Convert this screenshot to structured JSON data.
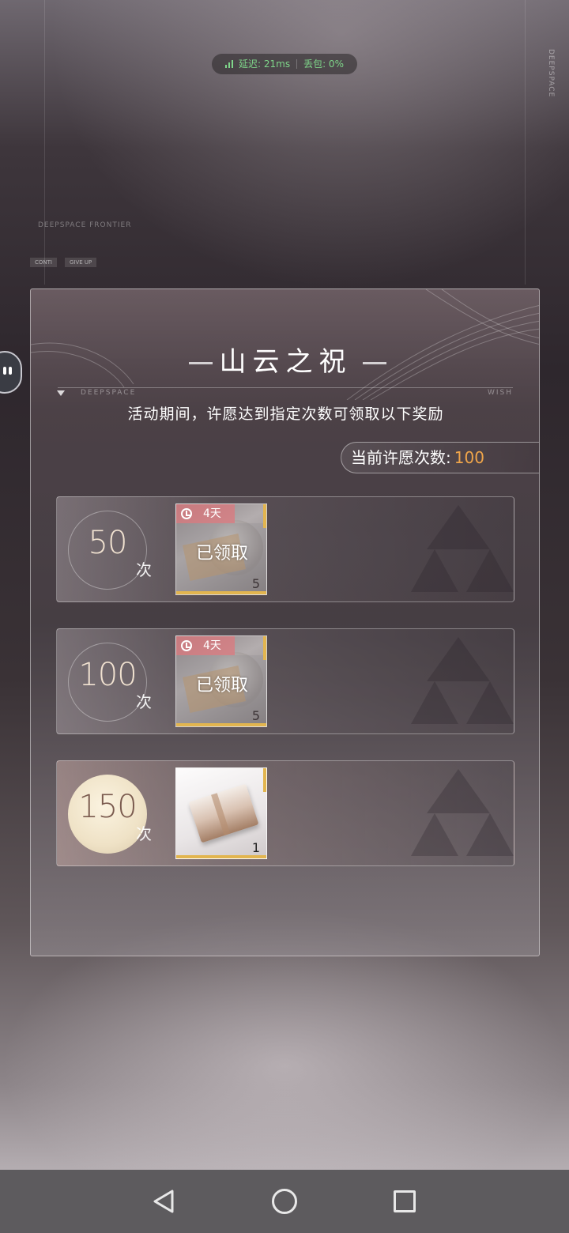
{
  "status": {
    "latency_label": "延迟: 21ms",
    "loss_label": "丢包: 0%",
    "color": "#7fd68a"
  },
  "background": {
    "brand_vertical": "DEEPSPACE",
    "small_text": "DEEPSPACE FRONTIER",
    "buttons": [
      "CONTI",
      "GIVE UP"
    ]
  },
  "modal": {
    "title": "山云之祝",
    "tag_left": "DEEPSPACE",
    "tag_right": "WISH",
    "subtitle": "活动期间，许愿达到指定次数可领取以下奖励",
    "count_label": "当前许愿次数:",
    "count_value": "100"
  },
  "rewards": [
    {
      "threshold": "50",
      "unit": "次",
      "item": {
        "timer": "4天",
        "claimed": "已领取",
        "quantity": "5"
      },
      "state": "claimed"
    },
    {
      "threshold": "100",
      "unit": "次",
      "item": {
        "timer": "4天",
        "claimed": "已领取",
        "quantity": "5"
      },
      "state": "claimed"
    },
    {
      "threshold": "150",
      "unit": "次",
      "item": {
        "quantity": "1"
      },
      "state": "locked"
    }
  ],
  "colors": {
    "accent_orange": "#f0a54a",
    "gold": "#e2b54f",
    "timer_red": "#dc787d"
  },
  "navbar": {
    "icons": [
      "back-icon",
      "home-icon",
      "recent-apps-icon"
    ]
  }
}
